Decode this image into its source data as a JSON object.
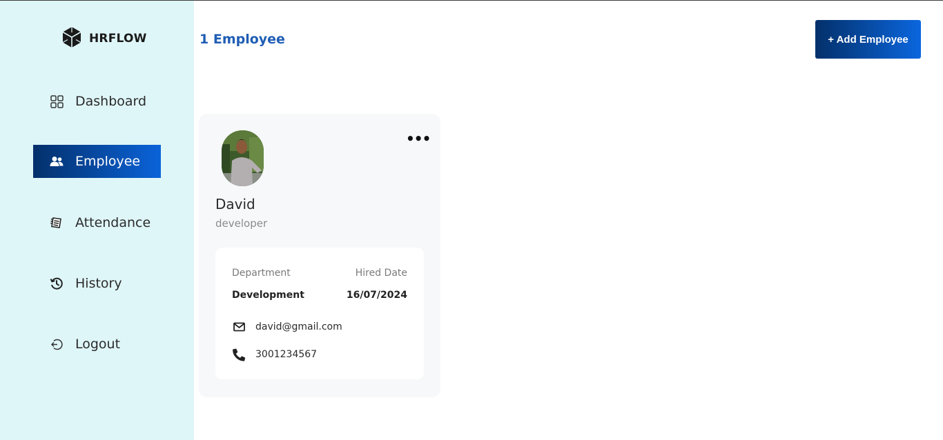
{
  "brand": {
    "name": "HRFLOW",
    "icon": "cube-logo-icon"
  },
  "sidebar": {
    "items": [
      {
        "label": "Dashboard",
        "icon": "grid-icon",
        "active": false
      },
      {
        "label": "Employee",
        "icon": "users-icon",
        "active": true
      },
      {
        "label": "Attendance",
        "icon": "notebook-icon",
        "active": false
      },
      {
        "label": "History",
        "icon": "history-icon",
        "active": false
      },
      {
        "label": "Logout",
        "icon": "logout-icon",
        "active": false
      }
    ]
  },
  "header": {
    "count_title": "1 Employee",
    "add_button_label": "+ Add Employee"
  },
  "employees": [
    {
      "name": "David",
      "role": "developer",
      "department_label": "Department",
      "department": "Development",
      "hired_label": "Hired Date",
      "hired_date": "16/07/2024",
      "email": "david@gmail.com",
      "phone": "3001234567"
    }
  ],
  "colors": {
    "sidebar_bg": "#dff6f8",
    "accent_dark": "#04306b",
    "accent_light": "#0a63d9",
    "title_blue": "#1e5db4"
  }
}
